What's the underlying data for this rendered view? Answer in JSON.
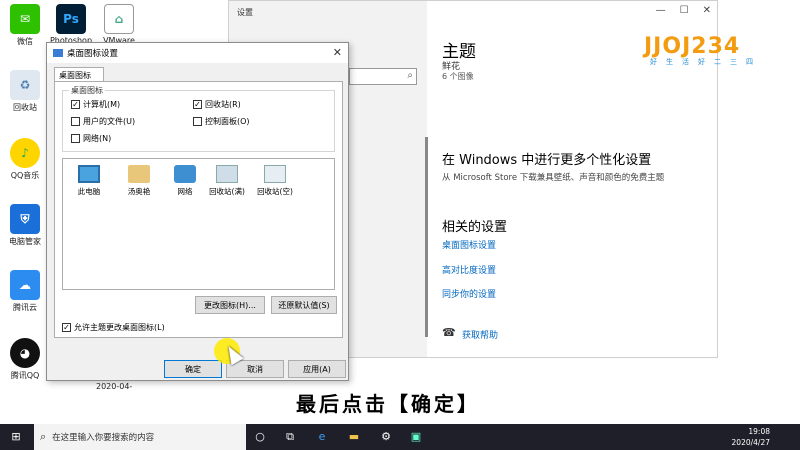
{
  "desktop": {
    "icons": [
      {
        "label": "微信",
        "icon": "wechat-icon"
      },
      {
        "label": "Photoshop",
        "icon": "photoshop-icon"
      },
      {
        "label": "VMware",
        "icon": "vmware-icon"
      },
      {
        "label": "回收站",
        "icon": "recycle-bin-icon"
      },
      {
        "label": "QQ音乐",
        "icon": "qq-music-icon"
      },
      {
        "label": "电脑管家",
        "icon": "pc-manager-icon"
      },
      {
        "label": "腾讯云",
        "icon": "cloud-icon"
      },
      {
        "label": "腾讯QQ",
        "icon": "qq-icon"
      }
    ],
    "date_fragment": "2020-04-"
  },
  "settings": {
    "window_title": "设置",
    "theme_title": "主题",
    "theme_name": "鲜花",
    "theme_count": "6 个图像",
    "personalize_heading": "在 Windows 中进行更多个性化设置",
    "personalize_desc": "从 Microsoft Store 下载兼具壁纸、声音和颜色的免费主题",
    "related_heading": "相关的设置",
    "links": [
      "桌面图标设置",
      "高对比度设置",
      "同步你的设置"
    ],
    "help": "获取帮助"
  },
  "logo": {
    "text": "JJOJ234",
    "subtitle": "好生活好二三四"
  },
  "dialog": {
    "title": "桌面图标设置",
    "tab": "桌面图标",
    "group_label": "桌面图标",
    "checkboxes": [
      {
        "label": "计算机(M)",
        "checked": true
      },
      {
        "label": "回收站(R)",
        "checked": true
      },
      {
        "label": "用户的文件(U)",
        "checked": false
      },
      {
        "label": "控制面板(O)",
        "checked": false
      },
      {
        "label": "网络(N)",
        "checked": false
      }
    ],
    "icons": [
      "此电脑",
      "汤奥艳",
      "网络",
      "回收站(满)",
      "回收站(空)"
    ],
    "change_icon": "更改图标(H)...",
    "restore_default": "还原默认值(S)",
    "allow_themes": "允许主题更改桌面图标(L)",
    "ok": "确定",
    "cancel": "取消",
    "apply": "应用(A)"
  },
  "caption": "最后点击【确定】",
  "taskbar": {
    "search_placeholder": "在这里输入你要搜索的内容",
    "time": "19:08",
    "date": "2020/4/27"
  },
  "colors": {
    "accent": "#0078d7",
    "link": "#0067c0",
    "taskbar": "#1f1f2a"
  }
}
